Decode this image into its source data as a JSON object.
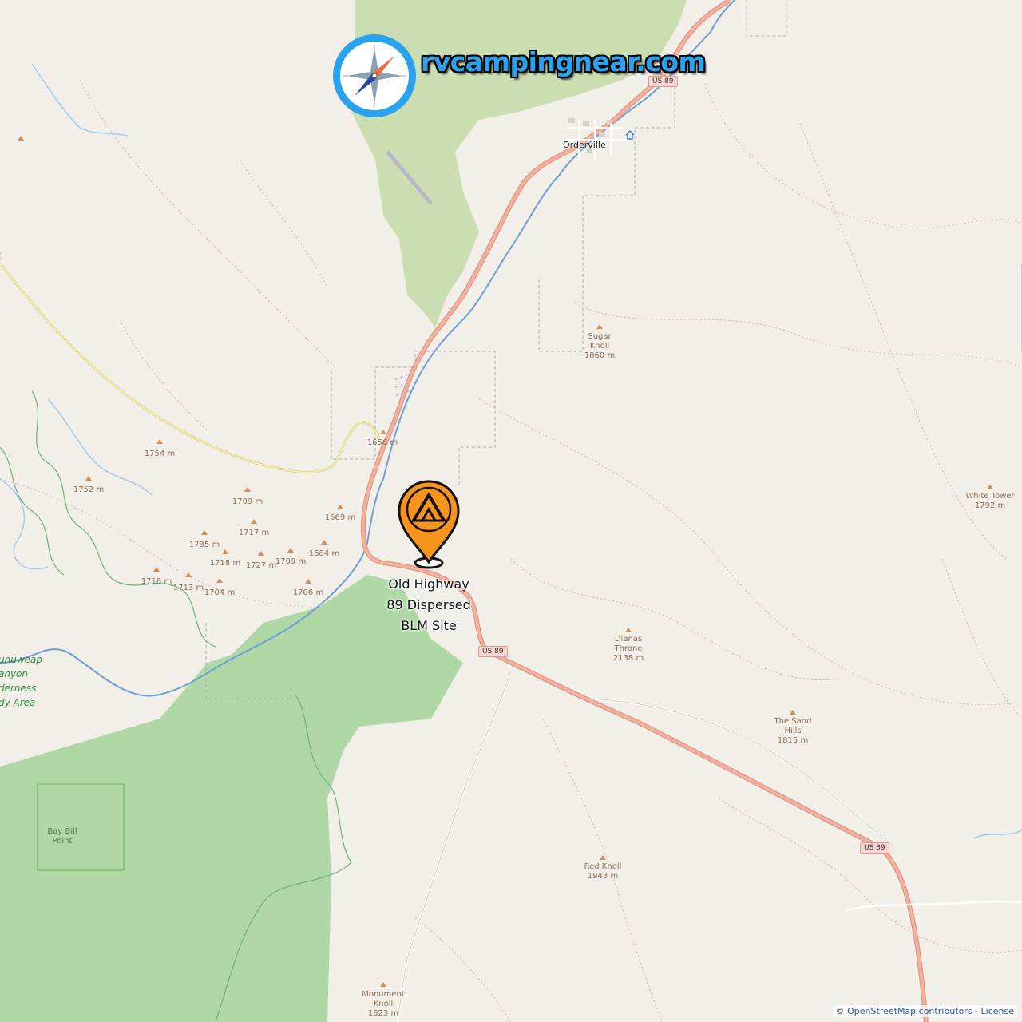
{
  "brand": {
    "text": "rvcampingnear.com",
    "accent": "#29a3f0",
    "icon": "compass-icon"
  },
  "marker": {
    "icon": "campsite-tent-icon",
    "color": "#f7941d",
    "label_lines": [
      "Old Highway",
      "89 Dispersed",
      "BLM Site"
    ]
  },
  "places": {
    "town": "Orderville",
    "wilderness_lines": [
      "unuweap",
      "anyon",
      "derness",
      "dy Area"
    ],
    "bay_bill": [
      "Bay Bill",
      "Point"
    ]
  },
  "peaks": [
    {
      "name": "Sugar",
      "name2": "Knoll",
      "elev": "1860 m"
    },
    {
      "name": "",
      "name2": "",
      "elev": "1656 m"
    },
    {
      "name": "",
      "name2": "",
      "elev": "1754 m"
    },
    {
      "name": "",
      "name2": "",
      "elev": "1752 m"
    },
    {
      "name": "",
      "name2": "",
      "elev": "1709 m"
    },
    {
      "name": "",
      "name2": "",
      "elev": "1669 m"
    },
    {
      "name": "",
      "name2": "",
      "elev": "1717 m"
    },
    {
      "name": "",
      "name2": "",
      "elev": "1735 m"
    },
    {
      "name": "",
      "name2": "",
      "elev": "1684 m"
    },
    {
      "name": "",
      "name2": "",
      "elev": "1718 m"
    },
    {
      "name": "",
      "name2": "",
      "elev": "1727 m"
    },
    {
      "name": "",
      "name2": "",
      "elev": "1709 m"
    },
    {
      "name": "",
      "name2": "",
      "elev": "1718 m"
    },
    {
      "name": "",
      "name2": "",
      "elev": "1713 m"
    },
    {
      "name": "",
      "name2": "",
      "elev": "1704 m"
    },
    {
      "name": "",
      "name2": "",
      "elev": "1706 m"
    },
    {
      "name": "Dianas",
      "name2": "Throne",
      "elev": "2138 m"
    },
    {
      "name": "The Sand",
      "name2": "Hills",
      "elev": "1815 m"
    },
    {
      "name": "White Tower",
      "name2": "",
      "elev": "1792 m"
    },
    {
      "name": "Red Knoll",
      "name2": "",
      "elev": "1943 m"
    },
    {
      "name": "Monument",
      "name2": "Knoll",
      "elev": "1823 m"
    }
  ],
  "shields": [
    "US 89",
    "US 89",
    "US 89"
  ],
  "attribution": {
    "prefix": "©",
    "osm": "OpenStreetMap contributors",
    "sep": " - ",
    "license": "License"
  }
}
